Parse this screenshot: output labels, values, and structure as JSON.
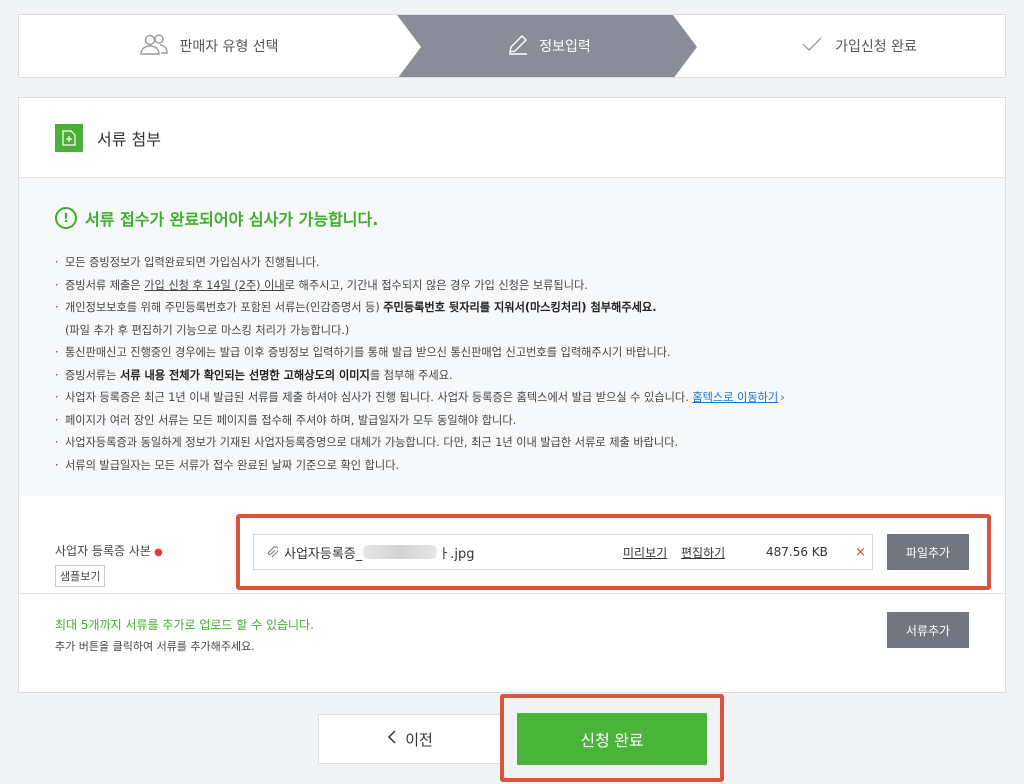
{
  "stepper": {
    "steps": [
      {
        "label": "판매자 유형 선택",
        "icon": "users-icon"
      },
      {
        "label": "정보입력",
        "icon": "pencil-icon"
      },
      {
        "label": "가입신청 완료",
        "icon": "check-icon"
      }
    ],
    "active_index": 1,
    "active_color": "#8a8d99"
  },
  "section": {
    "title": "서류 첨부",
    "icon": "document-add-icon"
  },
  "notice": {
    "title": "서류 접수가 완료되어야 심사가 가능합니다.",
    "item1": "모든 증빙정보가 입력완료되면 가입심사가 진행됩니다.",
    "item2_a": "증빙서류 제출은 ",
    "item2_u": "가입 신청 후 14일 (2주) 이내",
    "item2_b": "로 해주시고, 기간내 접수되지 않은 경우 가입 신청은 보류됩니다.",
    "item3_a": "개인정보보호를 위해 주민등록번호가 포함된 서류는(인감증명서 등) ",
    "item3_b": "주민등록번호 뒷자리를 지워서(마스킹처리) 첨부해주세요.",
    "item3_cont": "(파일 추가 후 편집하기 기능으로 마스킹 처리가 가능합니다.)",
    "item4": "통신판매신고 진행중인 경우에는 발급 이후 증빙정보 입력하기를 통해 발급 받으신 통신판매업 신고번호를 입력해주시기 바랍니다.",
    "item5_a": "증빙서류는 ",
    "item5_b": "서류 내용 전체가 확인되는 선명한 고해상도의 이미지",
    "item5_c": "를 첨부해 주세요.",
    "item6_a": "사업자 등록증은 최근 1년 이내 발급된 서류를 제출 하셔야 심사가 진행 됩니다. 사업자 등록증은 홈텍스에서 발급 받으실 수 있습니다. ",
    "item6_link": "홈텍스로 이동하기",
    "item6_arrow": "›",
    "item7": "페이지가 여러 장인 서류는 모든 페이지를 접수해 주셔야 하며, 발급일자가 모두 동일해야 합니다.",
    "item8": "사업자등록증과 동일하게 정보가 기재된 사업자등록증명으로 대체가 가능합니다. 다만, 최근 1년 이내 발급한 서류로 제출 바랍니다.",
    "item9": "서류의 발급일자는 모든 서류가 접수 완료된 날짜 기준으로 확인 합니다."
  },
  "upload": {
    "label": "사업자 등록증 사본",
    "required_mark": "●",
    "sample_button": "샘플보기",
    "file_name_prefix": "사업자등록증_",
    "file_name_suffix": "ㅏ.jpg",
    "preview_link": "미리보기",
    "edit_link": "편집하기",
    "file_size": "487.56 KB",
    "remove_symbol": "×",
    "add_file_button": "파일추가"
  },
  "more_docs": {
    "green_text": "최대 5개까지 서류를 추가로 업로드 할 수 있습니다.",
    "sub_text": "추가 버튼을 클릭하여 서류를 추가해주세요.",
    "add_doc_button": "서류추가"
  },
  "footer": {
    "prev_button": "이전",
    "submit_button": "신청 완료"
  },
  "colors": {
    "accent_green": "#4ab33a",
    "highlight_red": "#d9553c",
    "gray_button": "#73767f"
  }
}
